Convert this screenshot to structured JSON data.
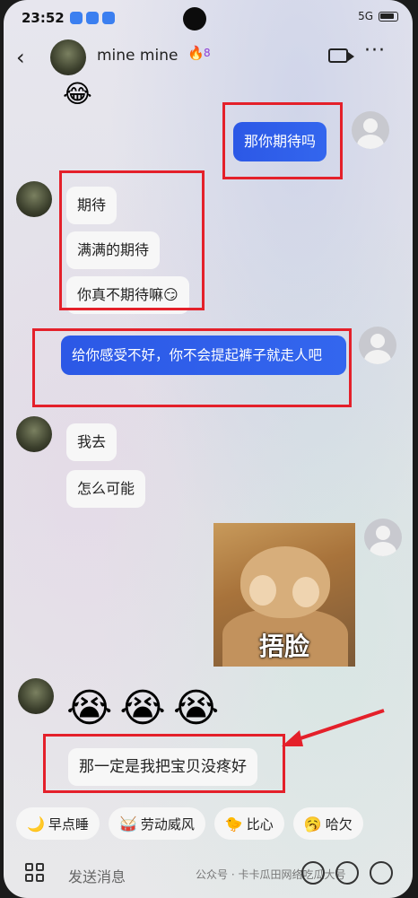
{
  "status_bar": {
    "time": "23:52",
    "network": "5G"
  },
  "header": {
    "back_icon": "chevron-left-icon",
    "contact_name": "mine  mine",
    "flame_icon": "flame-icon",
    "flame_count": "8",
    "video_icon": "video-call-icon",
    "more_icon": "more-icon"
  },
  "messages": {
    "sent_1": "那你期待吗",
    "recv_1": "期待",
    "recv_2": "满满的期待",
    "recv_3": "你真不期待嘛😏",
    "sent_2": "给你感受不好，你不会提起裤子就走人吧",
    "recv_4": "我去",
    "recv_5": "怎么可能",
    "sticker_caption": "捂脸",
    "recv_emojis": [
      "😭",
      "😭",
      "😭"
    ],
    "recv_6": "那一定是我把宝贝没疼好"
  },
  "quick_replies": [
    {
      "icon": "🌙",
      "label": "早点睡"
    },
    {
      "icon": "🥁",
      "label": "劳动威风"
    },
    {
      "icon": "🐤",
      "label": "比心"
    },
    {
      "icon": "🥱",
      "label": "哈欠"
    }
  ],
  "input_bar": {
    "placeholder": "发送消息",
    "watermark": "公众号 · 卡卡瓜田网络吃瓜大号"
  },
  "colors": {
    "sent_bubble": "#2c58e6",
    "highlight_box": "#e4202a",
    "flame": "#8e3fd6"
  }
}
